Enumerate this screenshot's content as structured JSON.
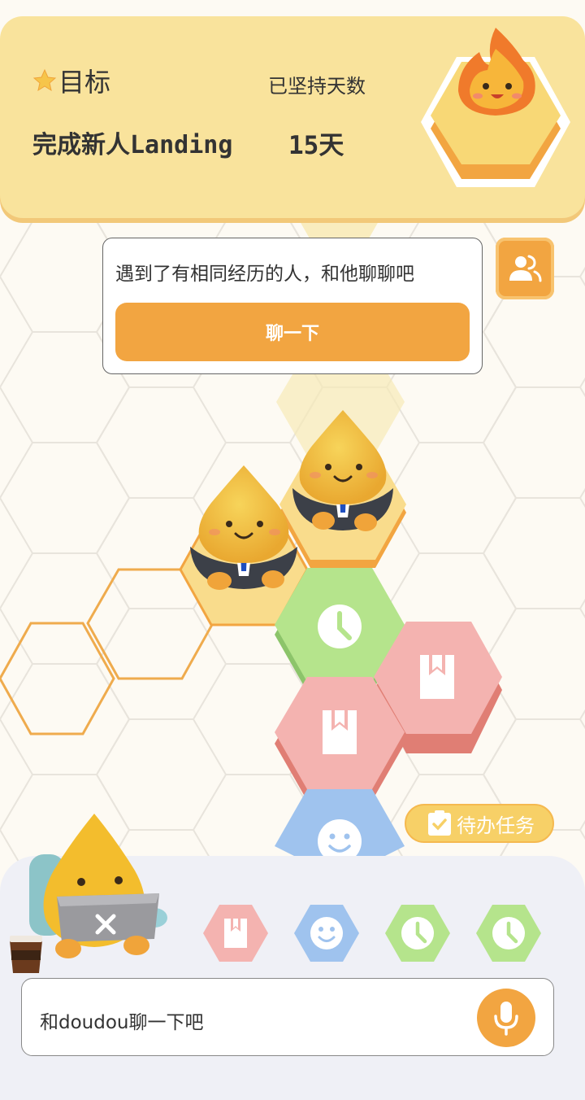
{
  "header": {
    "goal_title": "目标",
    "goal_text": "完成新人Landing",
    "days_label": "已坚持天数",
    "days_value": "15天"
  },
  "prompt": {
    "text": "遇到了有相同经历的人，和他聊聊吧",
    "button_label": "聊一下"
  },
  "todo": {
    "label": "待办任务"
  },
  "input": {
    "placeholder": "和doudou聊一下吧"
  },
  "map_tiles": [
    {
      "icon": "clock-icon",
      "color": "#b5e48c"
    },
    {
      "icon": "bookmark-icon",
      "color": "#f4b3b0"
    },
    {
      "icon": "bookmark-icon",
      "color": "#f4b3b0"
    },
    {
      "icon": "smile-icon",
      "color": "#9fc3ee"
    }
  ],
  "quick_actions": [
    {
      "icon": "bookmark-icon",
      "color": "#f4b3b0"
    },
    {
      "icon": "smile-icon",
      "color": "#9fc3ee"
    },
    {
      "icon": "clock-icon",
      "color": "#b5e48c"
    },
    {
      "icon": "clock-icon",
      "color": "#b5e48c"
    }
  ],
  "colors": {
    "accent": "#f2a541",
    "header_bg": "#f9e39c",
    "panel_bg": "#eff0f6"
  }
}
